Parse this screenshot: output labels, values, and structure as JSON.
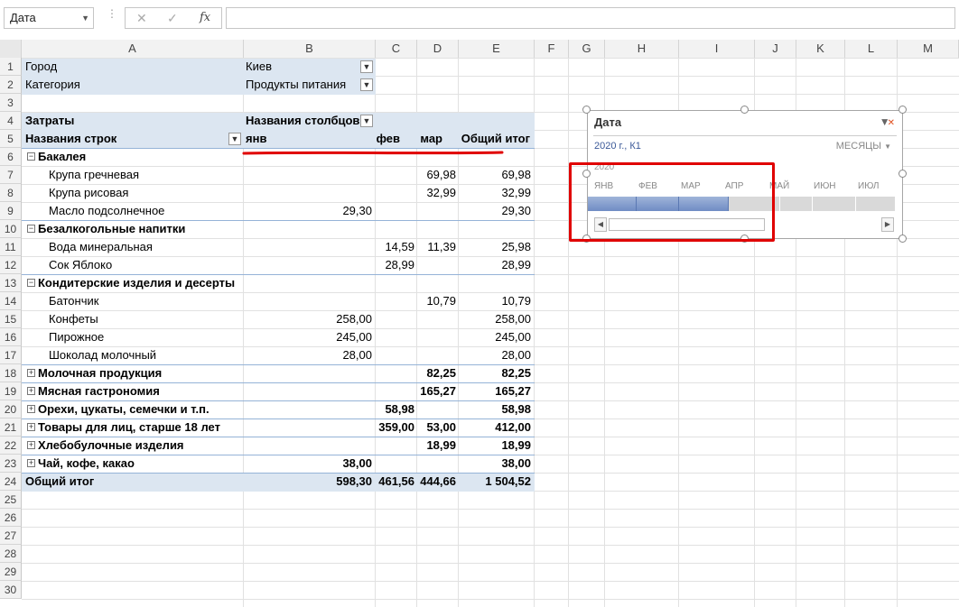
{
  "formula_bar": {
    "name_box": "Дата",
    "fx_label": "fx",
    "cancel": "✕",
    "confirm": "✓",
    "dots": "⋮",
    "formula": ""
  },
  "columns": [
    "A",
    "B",
    "C",
    "D",
    "E",
    "F",
    "G",
    "H",
    "I",
    "J",
    "K",
    "L",
    "M"
  ],
  "rows": [
    "1",
    "2",
    "3",
    "4",
    "5",
    "6",
    "7",
    "8",
    "9",
    "10",
    "11",
    "12",
    "13",
    "14",
    "15",
    "16",
    "17",
    "18",
    "19",
    "20",
    "21",
    "22",
    "23",
    "24",
    "25",
    "26",
    "27",
    "28",
    "29",
    "30"
  ],
  "filters": [
    {
      "label": "Город",
      "value": "Киев"
    },
    {
      "label": "Категория",
      "value": "Продукты питания"
    }
  ],
  "pivot_header": {
    "values_label": "Затраты",
    "col_labels": "Названия столбцов",
    "row_labels": "Названия строк",
    "months": [
      "янв",
      "фев",
      "мар"
    ],
    "grand_total": "Общий итог"
  },
  "pivot_rows": [
    {
      "type": "group",
      "sign": "⊟",
      "label": "Бакалея",
      "b": "",
      "c": "",
      "d": "",
      "e": ""
    },
    {
      "type": "item",
      "label": "Крупа гречневая",
      "b": "",
      "c": "",
      "d": "69,98",
      "e": "69,98"
    },
    {
      "type": "item",
      "label": "Крупа рисовая",
      "b": "",
      "c": "",
      "d": "32,99",
      "e": "32,99"
    },
    {
      "type": "item",
      "label": "Масло подсолнечное",
      "b": "29,30",
      "c": "",
      "d": "",
      "e": "29,30"
    },
    {
      "type": "group",
      "sign": "⊟",
      "label": "Безалкогольные напитки",
      "b": "",
      "c": "",
      "d": "",
      "e": ""
    },
    {
      "type": "item",
      "label": "Вода минеральная",
      "b": "",
      "c": "14,59",
      "d": "11,39",
      "e": "25,98"
    },
    {
      "type": "item",
      "label": "Сок Яблоко",
      "b": "",
      "c": "28,99",
      "d": "",
      "e": "28,99"
    },
    {
      "type": "group",
      "sign": "⊟",
      "label": "Кондитерские изделия и десерты",
      "b": "",
      "c": "",
      "d": "",
      "e": ""
    },
    {
      "type": "item",
      "label": "Батончик",
      "b": "",
      "c": "",
      "d": "10,79",
      "e": "10,79"
    },
    {
      "type": "item",
      "label": "Конфеты",
      "b": "258,00",
      "c": "",
      "d": "",
      "e": "258,00"
    },
    {
      "type": "item",
      "label": "Пирожное",
      "b": "245,00",
      "c": "",
      "d": "",
      "e": "245,00"
    },
    {
      "type": "item",
      "label": "Шоколад молочный",
      "b": "28,00",
      "c": "",
      "d": "",
      "e": "28,00"
    },
    {
      "type": "collapsed",
      "sign": "⊞",
      "label": "Молочная продукция",
      "b": "",
      "c": "",
      "d": "82,25",
      "e": "82,25"
    },
    {
      "type": "collapsed",
      "sign": "⊞",
      "label": "Мясная гастрономия",
      "b": "",
      "c": "",
      "d": "165,27",
      "e": "165,27"
    },
    {
      "type": "collapsed",
      "sign": "⊞",
      "label": "Орехи, цукаты, семечки и т.п.",
      "b": "",
      "c": "58,98",
      "d": "",
      "e": "58,98"
    },
    {
      "type": "collapsed",
      "sign": "⊞",
      "label": "Товары для лиц, старше 18 лет",
      "b": "",
      "c": "359,00",
      "d": "53,00",
      "e": "412,00"
    },
    {
      "type": "collapsed",
      "sign": "⊞",
      "label": "Хлебобулочные изделия",
      "b": "",
      "c": "",
      "d": "18,99",
      "e": "18,99"
    },
    {
      "type": "collapsed",
      "sign": "⊞",
      "label": "Чай, кофе, какао",
      "b": "38,00",
      "c": "",
      "d": "",
      "e": "38,00"
    },
    {
      "type": "total",
      "label": "Общий итог",
      "b": "598,30",
      "c": "461,56",
      "d": "444,66",
      "e": "1 504,52"
    }
  ],
  "timeline": {
    "title": "Дата",
    "range": "2020 г., К1",
    "level": "МЕСЯЦЫ",
    "year": "2020",
    "months": [
      "ЯНВ",
      "ФЕВ",
      "МАР",
      "АПР",
      "МАЙ",
      "ИЮН",
      "ИЮЛ"
    ],
    "selected_months": 3
  },
  "colors": {
    "pivot_band": "#dce6f1",
    "annotation": "#e00000",
    "selection": "#6f8cc4"
  }
}
